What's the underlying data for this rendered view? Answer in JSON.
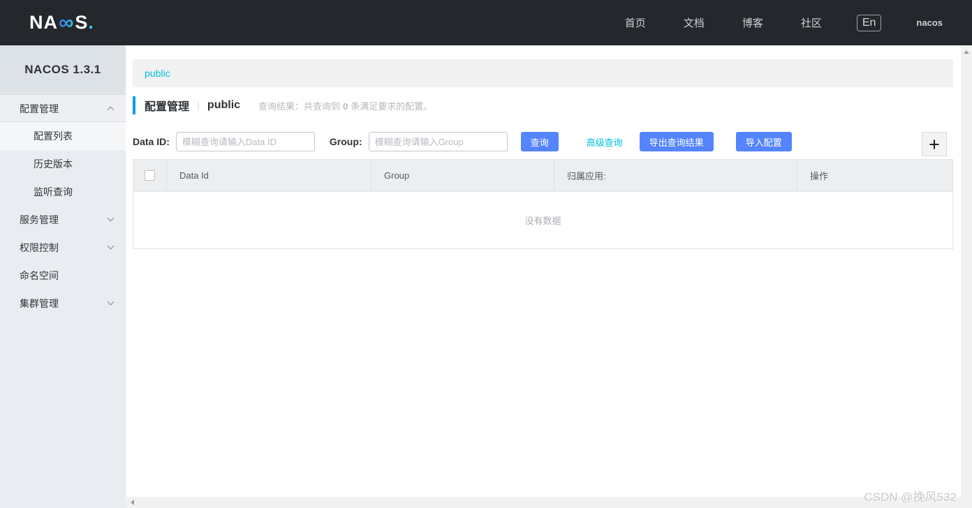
{
  "header": {
    "logo": {
      "part1": "NA",
      "part2": "∞",
      "part3": "S",
      "dot": "."
    },
    "nav": [
      {
        "label": "首页"
      },
      {
        "label": "文档"
      },
      {
        "label": "博客"
      },
      {
        "label": "社区"
      }
    ],
    "lang_button": "En",
    "username": "nacos"
  },
  "sidebar": {
    "title": "NACOS 1.3.1",
    "items": [
      {
        "label": "配置管理",
        "type": "group",
        "state": "expanded"
      },
      {
        "label": "配置列表",
        "type": "sub",
        "selected": true
      },
      {
        "label": "历史版本",
        "type": "sub",
        "selected": false
      },
      {
        "label": "监听查询",
        "type": "sub",
        "selected": false
      },
      {
        "label": "服务管理",
        "type": "group",
        "state": "collapsed"
      },
      {
        "label": "权限控制",
        "type": "group",
        "state": "collapsed"
      },
      {
        "label": "命名空间",
        "type": "item"
      },
      {
        "label": "集群管理",
        "type": "group",
        "state": "collapsed"
      }
    ]
  },
  "main": {
    "namespace_tab": "public",
    "page_title": "配置管理",
    "title_separator": "|",
    "namespace_name": "public",
    "query_result": {
      "prefix": "查询结果：共查询到",
      "count": "0",
      "suffix": "条满足要求的配置。"
    },
    "form": {
      "data_id_label": "Data ID:",
      "data_id_placeholder": "模糊查询请输入Data ID",
      "group_label": "Group:",
      "group_placeholder": "模糊查询请输入Group",
      "query_button": "查询",
      "advanced_query_link": "高级查询",
      "export_button": "导出查询结果",
      "import_button": "导入配置",
      "add_button": "+"
    },
    "table": {
      "columns": [
        "Data Id",
        "Group",
        "归属应用:",
        "操作"
      ],
      "empty_text": "没有数据"
    }
  },
  "watermark": "CSDN @挽风532",
  "colors": {
    "topbar_bg": "#24282d",
    "accent_cyan": "#00c1de",
    "primary_blue": "#5584ff",
    "title_bar_blue": "#0e9ee0",
    "sidebar_bg": "#e9ecf0"
  }
}
